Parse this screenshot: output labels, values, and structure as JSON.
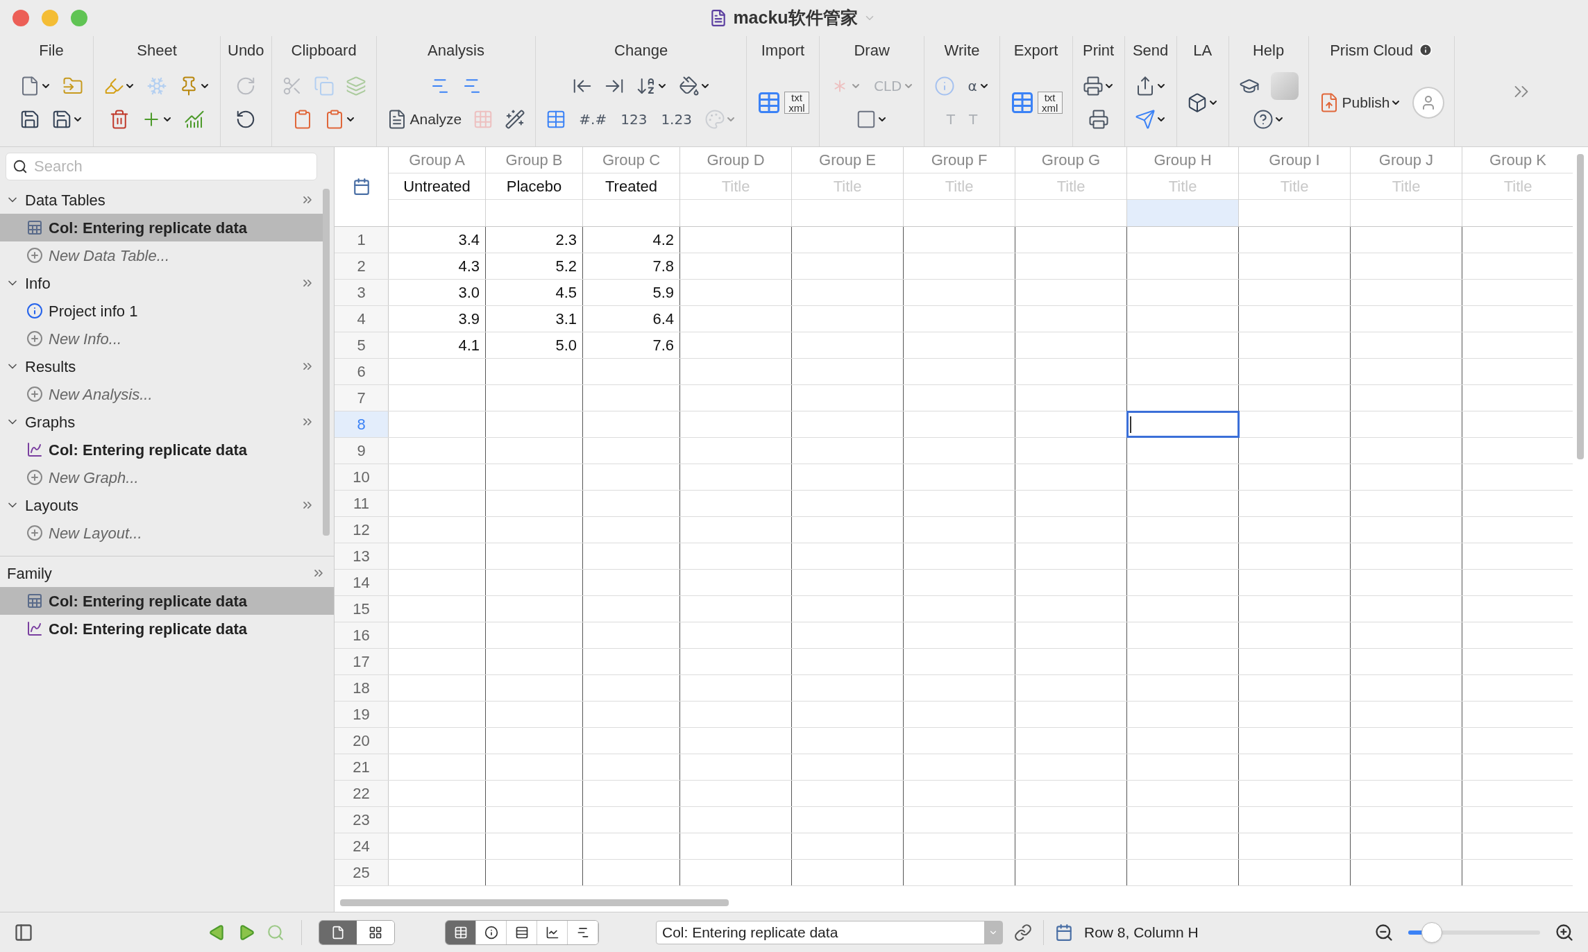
{
  "window": {
    "title": "macku软件管家"
  },
  "toolbar": [
    {
      "label": "File",
      "rows": [
        [
          {
            "kind": "new",
            "dropdown": true,
            "disabled": false
          },
          {
            "kind": "open",
            "dropdown": false,
            "disabled": false
          }
        ],
        [
          {
            "kind": "save",
            "dropdown": false,
            "disabled": false
          },
          {
            "kind": "saveas",
            "dropdown": true,
            "disabled": false
          }
        ]
      ]
    },
    {
      "label": "Sheet",
      "rows": [
        [
          {
            "kind": "highlight",
            "dropdown": true,
            "disabled": false
          },
          {
            "kind": "freeze",
            "dropdown": false,
            "disabled": true
          },
          {
            "kind": "pin",
            "dropdown": true,
            "disabled": false
          }
        ],
        [
          {
            "kind": "delete",
            "dropdown": false,
            "disabled": false
          },
          {
            "kind": "add",
            "dropdown": true,
            "disabled": false
          },
          {
            "kind": "addchart",
            "dropdown": false,
            "disabled": false
          }
        ]
      ]
    },
    {
      "label": "Undo",
      "rows": [
        [
          {
            "kind": "redo",
            "dropdown": false,
            "disabled": true
          }
        ],
        [
          {
            "kind": "undo",
            "dropdown": false,
            "disabled": false
          }
        ]
      ]
    },
    {
      "label": "Clipboard",
      "rows": [
        [
          {
            "kind": "cut",
            "dropdown": false,
            "disabled": true
          },
          {
            "kind": "copy",
            "dropdown": false,
            "disabled": true
          },
          {
            "kind": "duplicate",
            "dropdown": false,
            "disabled": true
          }
        ],
        [
          {
            "kind": "paste",
            "dropdown": false,
            "disabled": false
          },
          {
            "kind": "paste",
            "dropdown": true,
            "disabled": false
          }
        ]
      ]
    },
    {
      "label": "Analysis",
      "rows": [
        [
          {
            "kind": "analysis",
            "dropdown": false,
            "disabled": false
          },
          {
            "kind": "analysis",
            "dropdown": false,
            "disabled": false
          }
        ],
        [
          {
            "kind": "analyze",
            "label": "Analyze",
            "dropdown": false,
            "disabled": false
          },
          {
            "kind": "grid",
            "dropdown": false,
            "disabled": true
          },
          {
            "kind": "wand",
            "dropdown": false,
            "disabled": false
          }
        ]
      ]
    },
    {
      "label": "Change",
      "rows": [
        [
          {
            "kind": "insleft",
            "dropdown": false,
            "disabled": false
          },
          {
            "kind": "insright",
            "dropdown": false,
            "disabled": false
          },
          {
            "kind": "sort",
            "dropdown": true,
            "disabled": false
          },
          {
            "kind": "fill",
            "dropdown": true,
            "disabled": false
          }
        ],
        [
          {
            "kind": "table",
            "dropdown": false,
            "disabled": false
          },
          {
            "kind": "glyph",
            "glyph": "#.#",
            "dropdown": false,
            "disabled": false
          },
          {
            "kind": "glyph",
            "glyph": "123",
            "dropdown": false,
            "disabled": false
          },
          {
            "kind": "glyph",
            "glyph": "1.23",
            "dropdown": false,
            "disabled": false
          },
          {
            "kind": "palette",
            "dropdown": true,
            "disabled": true
          }
        ]
      ]
    },
    {
      "label": "Import",
      "rows": [
        [
          {
            "kind": "bigfile",
            "glyph": "txt xml",
            "dropdown": false,
            "disabled": false
          }
        ]
      ]
    },
    {
      "label": "Draw",
      "rows": [
        [
          {
            "kind": "star",
            "dropdown": true,
            "disabled": true
          },
          {
            "kind": "glyph",
            "glyph": "CLD",
            "dropdown": true,
            "disabled": true
          }
        ],
        [
          {
            "kind": "rect",
            "dropdown": true,
            "disabled": false
          }
        ]
      ]
    },
    {
      "label": "Write",
      "rows": [
        [
          {
            "kind": "info",
            "dropdown": false,
            "disabled": true
          },
          {
            "kind": "glyph",
            "glyph": "α",
            "dropdown": true,
            "disabled": false
          }
        ],
        [
          {
            "kind": "glyph",
            "glyph": "T",
            "dropdown": false,
            "disabled": true
          },
          {
            "kind": "glyph",
            "glyph": "T",
            "dropdown": false,
            "disabled": true
          }
        ]
      ]
    },
    {
      "label": "Export",
      "rows": [
        [
          {
            "kind": "bigfile",
            "glyph": "txt xml",
            "dropdown": false,
            "disabled": false
          }
        ]
      ]
    },
    {
      "label": "Print",
      "rows": [
        [
          {
            "kind": "print",
            "dropdown": true,
            "disabled": false
          }
        ],
        [
          {
            "kind": "print",
            "dropdown": false,
            "disabled": false
          }
        ]
      ]
    },
    {
      "label": "Send",
      "rows": [
        [
          {
            "kind": "share",
            "dropdown": true,
            "disabled": false
          }
        ],
        [
          {
            "kind": "send",
            "dropdown": true,
            "disabled": false
          }
        ]
      ]
    },
    {
      "label": "LA",
      "rows": [
        [
          {
            "kind": "cube",
            "dropdown": true,
            "disabled": false
          }
        ]
      ]
    },
    {
      "label": "Help",
      "rows": [
        [
          {
            "kind": "grad",
            "dropdown": false,
            "disabled": false
          },
          {
            "kind": "tile",
            "dropdown": false,
            "disabled": false
          }
        ],
        [
          {
            "kind": "help",
            "dropdown": true,
            "disabled": false
          }
        ]
      ]
    },
    {
      "label": "Prism Cloud",
      "info": true,
      "rows": [
        [
          {
            "kind": "publish",
            "label": "Publish",
            "dropdown": true,
            "disabled": false
          },
          {
            "kind": "avatar",
            "dropdown": false,
            "disabled": false
          }
        ]
      ]
    }
  ],
  "sidebar": {
    "search": {
      "placeholder": "Search"
    },
    "sections": [
      {
        "label": "Data Tables",
        "expanded": true,
        "items": [
          {
            "kind": "table",
            "label": "Col: Entering replicate data",
            "selected": true
          },
          {
            "kind": "new",
            "label": "New Data Table...",
            "selected": false
          }
        ]
      },
      {
        "label": "Info",
        "expanded": true,
        "items": [
          {
            "kind": "info",
            "label": "Project info 1",
            "selected": false
          },
          {
            "kind": "new",
            "label": "New Info...",
            "selected": false
          }
        ]
      },
      {
        "label": "Results",
        "expanded": true,
        "items": [
          {
            "kind": "new",
            "label": "New Analysis...",
            "selected": false
          }
        ]
      },
      {
        "label": "Graphs",
        "expanded": true,
        "items": [
          {
            "kind": "graph",
            "label": "Col: Entering replicate data",
            "selected": false
          },
          {
            "kind": "new",
            "label": "New Graph...",
            "selected": false
          }
        ]
      },
      {
        "label": "Layouts",
        "expanded": true,
        "items": [
          {
            "kind": "new",
            "label": "New Layout...",
            "selected": false
          }
        ]
      }
    ],
    "family": {
      "label": "Family",
      "items": [
        {
          "kind": "table",
          "label": "Col: Entering replicate data",
          "selected": true
        },
        {
          "kind": "graph",
          "label": "Col: Entering replicate data",
          "selected": false
        }
      ]
    }
  },
  "sheet": {
    "columns": [
      {
        "group": "Group A",
        "title": "Untreated",
        "selected": false
      },
      {
        "group": "Group B",
        "title": "Placebo",
        "selected": false
      },
      {
        "group": "Group C",
        "title": "Treated",
        "selected": false
      },
      {
        "group": "Group D",
        "placeholder": "Title",
        "selected": false
      },
      {
        "group": "Group E",
        "placeholder": "Title",
        "selected": false
      },
      {
        "group": "Group F",
        "placeholder": "Title",
        "selected": false
      },
      {
        "group": "Group G",
        "placeholder": "Title",
        "selected": false
      },
      {
        "group": "Group H",
        "placeholder": "Title",
        "selected": true
      },
      {
        "group": "Group I",
        "placeholder": "Title",
        "selected": false
      },
      {
        "group": "Group J",
        "placeholder": "Title",
        "selected": false
      },
      {
        "group": "Group K",
        "placeholder": "Title",
        "selected": false
      }
    ],
    "rows": [
      {
        "number": "1",
        "values": [
          "3.4",
          "2.3",
          "4.2"
        ],
        "selected": false
      },
      {
        "number": "2",
        "values": [
          "4.3",
          "5.2",
          "7.8"
        ],
        "selected": false
      },
      {
        "number": "3",
        "values": [
          "3.0",
          "4.5",
          "5.9"
        ],
        "selected": false
      },
      {
        "number": "4",
        "values": [
          "3.9",
          "3.1",
          "6.4"
        ],
        "selected": false
      },
      {
        "number": "5",
        "values": [
          "4.1",
          "5.0",
          "7.6"
        ],
        "selected": false
      },
      {
        "number": "6",
        "values": [],
        "selected": false
      },
      {
        "number": "7",
        "values": [],
        "selected": false
      },
      {
        "number": "8",
        "values": [],
        "selected": true
      },
      {
        "number": "9",
        "values": [],
        "selected": false
      },
      {
        "number": "10",
        "values": [],
        "selected": false
      },
      {
        "number": "11",
        "values": [],
        "selected": false
      },
      {
        "number": "12",
        "values": [],
        "selected": false
      },
      {
        "number": "13",
        "values": [],
        "selected": false
      },
      {
        "number": "14",
        "values": [],
        "selected": false
      },
      {
        "number": "15",
        "values": [],
        "selected": false
      },
      {
        "number": "16",
        "values": [],
        "selected": false
      },
      {
        "number": "17",
        "values": [],
        "selected": false
      },
      {
        "number": "18",
        "values": [],
        "selected": false
      },
      {
        "number": "19",
        "values": [],
        "selected": false
      },
      {
        "number": "20",
        "values": [],
        "selected": false
      },
      {
        "number": "21",
        "values": [],
        "selected": false
      },
      {
        "number": "22",
        "values": [],
        "selected": false
      },
      {
        "number": "23",
        "values": [],
        "selected": false
      },
      {
        "number": "24",
        "values": [],
        "selected": false
      },
      {
        "number": "25",
        "values": [],
        "selected": false
      }
    ]
  },
  "status_bar": {
    "page_views": [
      {
        "kind": "page",
        "selected": true
      },
      {
        "kind": "grid",
        "selected": false
      }
    ],
    "sheet_views": [
      {
        "kind": "table",
        "selected": true
      },
      {
        "kind": "info",
        "selected": false
      },
      {
        "kind": "rows",
        "selected": false
      },
      {
        "kind": "chart",
        "selected": false
      },
      {
        "kind": "layout",
        "selected": false
      }
    ],
    "sheet_name": "Col: Entering replicate data",
    "location": "Row 8, Column H",
    "zoom": {
      "level": 0.18
    }
  }
}
